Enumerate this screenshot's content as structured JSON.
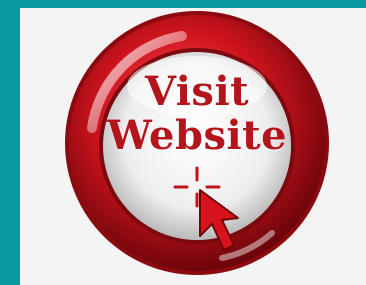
{
  "button": {
    "line1": "Visit",
    "line2": "Website"
  },
  "colors": {
    "background": "#0a9aa0",
    "ring_red": "#c4121b",
    "text_red": "#b3151c",
    "panel": "#f4f4f4"
  },
  "icons": {
    "cursor": "mouse-pointer-arrow-icon",
    "crosshair": "crosshair-icon"
  }
}
